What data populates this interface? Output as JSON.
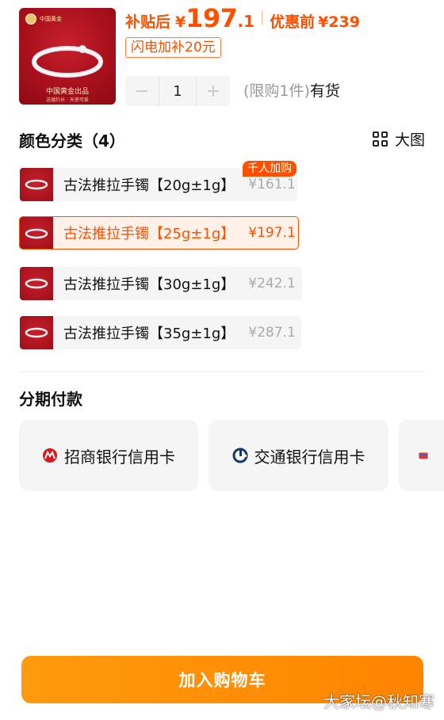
{
  "product": {
    "brand_name": "中国黄金",
    "image_caption": "中国黄金出品",
    "image_subcaption": "送婚约长 · 天使可爱",
    "price_label": "补贴后",
    "currency": "¥",
    "price_int": "197",
    "price_dec": ".1",
    "orig_label": "优惠前",
    "orig_price": "¥239",
    "flash_tag": "闪电加补20元",
    "quantity": "1",
    "minus": "−",
    "plus": "+",
    "limit_text": "(限购1件)",
    "stock_text": "有货"
  },
  "colors": {
    "title": "颜色分类（4）",
    "big_view_label": "大图",
    "hot_tag": "千人加购",
    "variants": [
      {
        "name": "古法推拉手镯【20g±1g】",
        "price": "¥161.1",
        "selected": false
      },
      {
        "name": "古法推拉手镯【25g±1g】",
        "price": "¥197.1",
        "selected": true
      },
      {
        "name": "古法推拉手镯【30g±1g】",
        "price": "¥242.1",
        "selected": false
      },
      {
        "name": "古法推拉手镯【35g±1g】",
        "price": "¥287.1",
        "selected": false
      }
    ]
  },
  "installment": {
    "title": "分期付款",
    "banks": [
      {
        "name": "招商银行信用卡",
        "icon": "cmb-bank-icon"
      },
      {
        "name": "交通银行信用卡",
        "icon": "bocom-bank-icon"
      },
      {
        "name": "",
        "icon": "bank-icon"
      }
    ]
  },
  "actions": {
    "add_to_cart": "加入购物车"
  },
  "watermark": "大家坛@秋知寒",
  "colors_theme": {
    "accent": "#ff5000",
    "cart_button": "#ff8c00"
  }
}
